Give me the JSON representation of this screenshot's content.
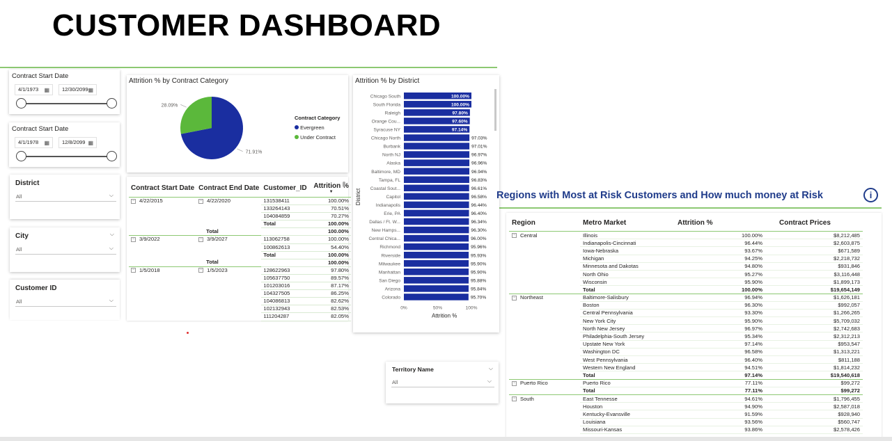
{
  "page": {
    "title": "CUSTOMER DASHBOARD"
  },
  "slicers": {
    "date1": {
      "label": "Contract Start Date",
      "from": "4/1/1973",
      "to": "12/30/2099"
    },
    "date2": {
      "label": "Contract Start Date",
      "from": "4/1/1978",
      "to": "12/8/2099"
    },
    "district": {
      "label": "District",
      "value": "All"
    },
    "city": {
      "label": "City",
      "value": "All"
    },
    "customer": {
      "label": "Customer ID",
      "value": "All"
    },
    "territory": {
      "label": "Territory Name",
      "value": "All"
    }
  },
  "pie": {
    "title": "Attrition % by Contract Category",
    "legend_title": "Contract Category",
    "colors": {
      "Evergreen": "#1a2ea0",
      "Under Contract": "#5bb83b"
    },
    "chart_data": {
      "type": "pie",
      "labels": [
        "Evergreen",
        "Under Contract"
      ],
      "values": [
        71.91,
        28.09
      ],
      "value_labels": [
        "71.91%",
        "28.09%"
      ]
    }
  },
  "table1": {
    "headers": [
      "Contract Start Date",
      "Contract End Date",
      "Customer_ID",
      "Attrition %"
    ],
    "rows": [
      [
        "4/22/2015",
        "4/22/2020",
        "131538411",
        "100.00%"
      ],
      [
        "",
        "",
        "133264143",
        "70.51%"
      ],
      [
        "",
        "",
        "104084859",
        "70.27%"
      ],
      [
        "",
        "",
        "Total",
        "100.00%"
      ],
      [
        "",
        "Total",
        "",
        "100.00%"
      ],
      [
        "3/9/2022",
        "3/9/2027",
        "113062758",
        "100.00%"
      ],
      [
        "",
        "",
        "100862613",
        "54.40%"
      ],
      [
        "",
        "",
        "Total",
        "100.00%"
      ],
      [
        "",
        "Total",
        "",
        "100.00%"
      ],
      [
        "1/5/2018",
        "1/5/2023",
        "128622963",
        "97.80%"
      ],
      [
        "",
        "",
        "105637750",
        "89.57%"
      ],
      [
        "",
        "",
        "101203016",
        "87.17%"
      ],
      [
        "",
        "",
        "104327505",
        "86.25%"
      ],
      [
        "",
        "",
        "104086813",
        "82.62%"
      ],
      [
        "",
        "",
        "102132943",
        "82.53%"
      ],
      [
        "",
        "",
        "111204287",
        "82.05%"
      ]
    ]
  },
  "district_chart": {
    "title": "Attrition % by District",
    "bar_color": "#1a2ea0",
    "chart_data": {
      "type": "bar",
      "orientation": "horizontal",
      "categories": [
        "Chicago South",
        "South Florida",
        "Raleigh",
        "Orange Cou...",
        "Syracuse NY",
        "Chicago North",
        "Burbank",
        "North NJ",
        "Alaska",
        "Baltimore, MD",
        "Tampa, FL",
        "Coastal Sout...",
        "Capitol",
        "Indianapolis",
        "Erie, PA",
        "Dallas / Ft. W...",
        "New Hamps...",
        "Central Chica...",
        "Richmond",
        "Riverside",
        "Milwaukee",
        "Manhattan",
        "San Diego",
        "Arizona",
        "Colorado"
      ],
      "values": [
        100.0,
        100.0,
        97.8,
        97.6,
        97.14,
        97.03,
        97.01,
        96.97,
        96.96,
        96.94,
        96.83,
        96.61,
        96.58,
        96.44,
        96.4,
        96.34,
        96.3,
        96.0,
        95.96,
        95.93,
        95.9,
        95.9,
        95.88,
        95.84,
        95.7
      ],
      "value_labels": [
        "100.00%",
        "100.00%",
        "97.80%",
        "97.60%",
        "97.14%",
        "97.03%",
        "97.01%",
        "96.97%",
        "96.96%",
        "96.94%",
        "96.83%",
        "96.61%",
        "96.58%",
        "96.44%",
        "96.40%",
        "96.34%",
        "96.30%",
        "96.00%",
        "95.96%",
        "95.93%",
        "95.90%",
        "95.90%",
        "95.88%",
        "95.84%",
        "95.70%"
      ],
      "inside_label_count": 5,
      "xticks": [
        "0%",
        "50%",
        "100%"
      ],
      "xlim": [
        0,
        100
      ],
      "xlabel": "Attrition %",
      "ylabel": "District"
    }
  },
  "risk": {
    "title": "Regions with Most at Risk Customers and How much money at Risk",
    "info_icon": "i",
    "headers": [
      "Region",
      "Metro Market",
      "Attrition %",
      "Contract Prices"
    ],
    "rows": [
      [
        "Central",
        "Illinois",
        "100.00%",
        "$8,212,485"
      ],
      [
        "",
        "Indianapolis-Cincinnati",
        "96.44%",
        "$2,603,875"
      ],
      [
        "",
        "Iowa-Nebraska",
        "93.67%",
        "$671,589"
      ],
      [
        "",
        "Michigan",
        "94.25%",
        "$2,218,732"
      ],
      [
        "",
        "Minnesota and Dakotas",
        "94.80%",
        "$931,846"
      ],
      [
        "",
        "North Ohio",
        "95.27%",
        "$3,116,448"
      ],
      [
        "",
        "Wisconsin",
        "95.90%",
        "$1,899,173"
      ],
      [
        "",
        "Total",
        "100.00%",
        "$19,654,149"
      ],
      [
        "Northeast",
        "Baltimore-Salisbury",
        "96.94%",
        "$1,626,181"
      ],
      [
        "",
        "Boston",
        "96.30%",
        "$992,057"
      ],
      [
        "",
        "Central Pennsylvania",
        "93.30%",
        "$1,266,265"
      ],
      [
        "",
        "New York City",
        "95.90%",
        "$5,709,032"
      ],
      [
        "",
        "North New Jersey",
        "96.97%",
        "$2,742,683"
      ],
      [
        "",
        "Philadelphia-South Jersey",
        "95.34%",
        "$2,312,213"
      ],
      [
        "",
        "Upstate New York",
        "97.14%",
        "$953,547"
      ],
      [
        "",
        "Washington DC",
        "96.58%",
        "$1,313,221"
      ],
      [
        "",
        "West Pennsylvania",
        "96.40%",
        "$811,188"
      ],
      [
        "",
        "Western New England",
        "94.51%",
        "$1,814,232"
      ],
      [
        "",
        "Total",
        "97.14%",
        "$19,540,618"
      ],
      [
        "Puerto Rico",
        "Puerto Rico",
        "77.11%",
        "$99,272"
      ],
      [
        "",
        "Total",
        "77.11%",
        "$99,272"
      ],
      [
        "South",
        "East Tennesse",
        "94.61%",
        "$1,796,455"
      ],
      [
        "",
        "Houston",
        "94.90%",
        "$2,587,018"
      ],
      [
        "",
        "Kentucky-Evansville",
        "91.59%",
        "$928,940"
      ],
      [
        "",
        "Louisiana",
        "93.56%",
        "$560,747"
      ],
      [
        "",
        "Missouri-Kansas",
        "93.86%",
        "$2,578,426"
      ]
    ]
  }
}
